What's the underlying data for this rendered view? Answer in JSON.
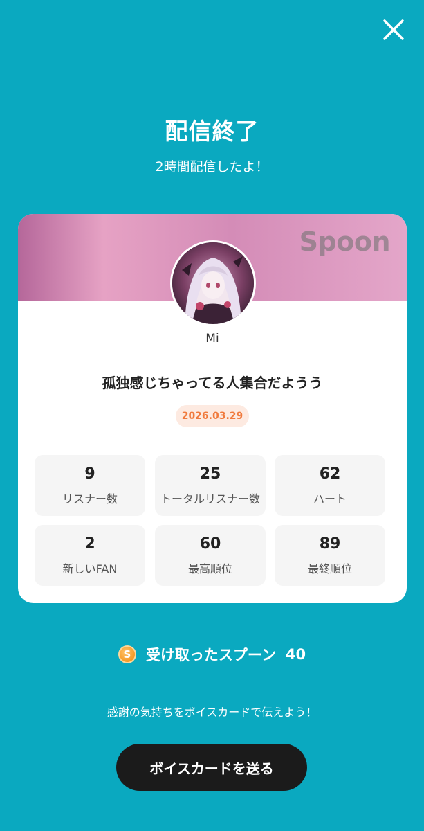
{
  "header": {
    "close_icon": "close-icon",
    "title": "配信終了",
    "subtitle": "2時間配信したよ！"
  },
  "card": {
    "brand": "Spoon",
    "banner_colors": [
      "#b5679a",
      "#e6a2c4",
      "#d48cb7"
    ],
    "username": "Mi",
    "live_title": "孤独感じちゃってる人集合だようう",
    "date": "2026.03.29",
    "stats": [
      {
        "value": "9",
        "label": "リスナー数"
      },
      {
        "value": "25",
        "label": "トータルリスナー数"
      },
      {
        "value": "62",
        "label": "ハート"
      },
      {
        "value": "2",
        "label": "新しいFAN"
      },
      {
        "value": "60",
        "label": "最高順位"
      },
      {
        "value": "89",
        "label": "最終順位"
      }
    ]
  },
  "spoons": {
    "icon": "spoon-coin-icon",
    "icon_letter": "S",
    "label": "受け取ったスプーン",
    "count": "40"
  },
  "footer": {
    "thanks_text": "感謝の気持ちをボイスカードで伝えよう！",
    "voice_card_button": "ボイスカードを送る"
  },
  "colors": {
    "background": "#0aa9c0",
    "date_badge_text": "#f07a3d",
    "button": "#1b1b1b"
  }
}
